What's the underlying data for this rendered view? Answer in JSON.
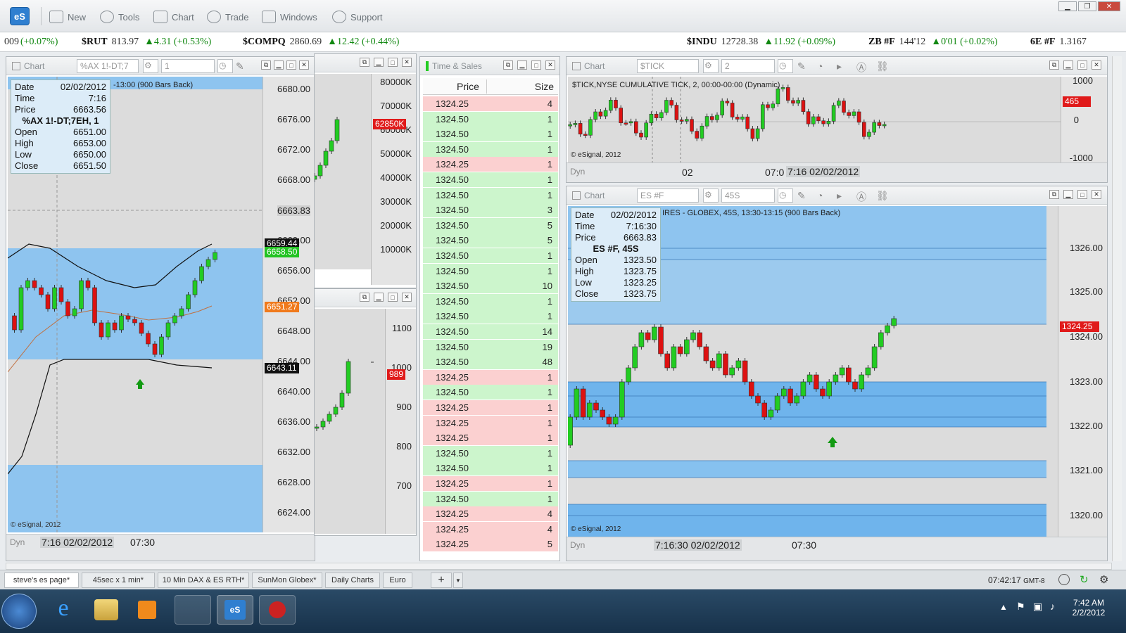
{
  "app": {
    "logo": "eS",
    "toolbar": [
      {
        "label": "New",
        "icon": "new-icon"
      },
      {
        "label": "Tools",
        "icon": "tools-icon"
      },
      {
        "label": "Chart",
        "icon": "chart-icon"
      },
      {
        "label": "Trade",
        "icon": "trade-icon"
      },
      {
        "label": "Windows",
        "icon": "windows-icon"
      },
      {
        "label": "Support",
        "icon": "help-icon"
      }
    ]
  },
  "ticker": [
    {
      "sym": "",
      "last": "009",
      "chg": "(+0.07%)"
    },
    {
      "sym": "$RUT",
      "last": "813.97",
      "chg": "▲4.31 (+0.53%)"
    },
    {
      "sym": "$COMPQ",
      "last": "2860.69",
      "chg": "▲12.42 (+0.44%)"
    },
    {
      "sym": "$INDU",
      "last": "12728.38",
      "chg": "▲11.92 (+0.09%)"
    },
    {
      "sym": "ZB #F",
      "last": "144'12",
      "chg": "▲0'01 (+0.02%)"
    },
    {
      "sym": "6E #F",
      "last": "1.3167",
      "chg": ""
    }
  ],
  "chart1": {
    "title": "Chart",
    "symbol": "%AX 1!-DT;7",
    "interval": "1",
    "legend": "-13:00 (900 Bars Back)",
    "tooltip": {
      "date_label": "Date",
      "date": "02/02/2012",
      "time_label": "Time",
      "time": "7:16",
      "price_label": "Price",
      "price": "6663.56",
      "name": "%AX 1!-DT;7EH, 1",
      "open_label": "Open",
      "open": "6651.00",
      "high_label": "High",
      "high": "6653.00",
      "low_label": "Low",
      "low": "6650.00",
      "close_label": "Close",
      "close": "6651.50"
    },
    "yticks": [
      "6680.00",
      "6676.00",
      "6672.00",
      "6668.00",
      "6663.83",
      "6660.00",
      "6656.00",
      "6652.00",
      "6648.00",
      "6644.00",
      "6640.00",
      "6636.00",
      "6632.00",
      "6628.00",
      "6624.00"
    ],
    "tags": [
      "6659.44",
      "6658.50",
      "6651.27",
      "6643.11"
    ],
    "copyright": "© eSignal, 2012",
    "dyn": "Dyn",
    "xtime": "7:16 02/02/2012",
    "xlabel": "07:30"
  },
  "chart2": {
    "yticks": [
      "80000K",
      "70000K",
      "60000K",
      "50000K",
      "40000K",
      "30000K",
      "20000K",
      "10000K"
    ],
    "tag": "62850K"
  },
  "chart3": {
    "yticks": [
      "1100",
      "1000",
      "900",
      "800",
      "700"
    ],
    "tag": "989"
  },
  "ts": {
    "title": "Time & Sales",
    "col_price": "Price",
    "col_size": "Size",
    "rows": [
      [
        "1324.25",
        "4",
        "dn"
      ],
      [
        "1324.50",
        "1",
        "up"
      ],
      [
        "1324.50",
        "1",
        "up"
      ],
      [
        "1324.50",
        "1",
        "up"
      ],
      [
        "1324.25",
        "1",
        "dn"
      ],
      [
        "1324.50",
        "1",
        "up"
      ],
      [
        "1324.50",
        "1",
        "up"
      ],
      [
        "1324.50",
        "3",
        "up"
      ],
      [
        "1324.50",
        "5",
        "up"
      ],
      [
        "1324.50",
        "5",
        "up"
      ],
      [
        "1324.50",
        "1",
        "up"
      ],
      [
        "1324.50",
        "1",
        "up"
      ],
      [
        "1324.50",
        "10",
        "up"
      ],
      [
        "1324.50",
        "1",
        "up"
      ],
      [
        "1324.50",
        "1",
        "up"
      ],
      [
        "1324.50",
        "14",
        "up"
      ],
      [
        "1324.50",
        "19",
        "up"
      ],
      [
        "1324.50",
        "48",
        "up"
      ],
      [
        "1324.25",
        "1",
        "dn"
      ],
      [
        "1324.50",
        "1",
        "up"
      ],
      [
        "1324.25",
        "1",
        "dn"
      ],
      [
        "1324.25",
        "1",
        "dn"
      ],
      [
        "1324.25",
        "1",
        "dn"
      ],
      [
        "1324.50",
        "1",
        "up"
      ],
      [
        "1324.50",
        "1",
        "up"
      ],
      [
        "1324.25",
        "1",
        "dn"
      ],
      [
        "1324.50",
        "1",
        "up"
      ],
      [
        "1324.25",
        "4",
        "dn"
      ],
      [
        "1324.25",
        "4",
        "dn"
      ],
      [
        "1324.25",
        "5",
        "dn"
      ]
    ]
  },
  "chart4": {
    "title": "Chart",
    "symbol": "$TICK",
    "interval": "2",
    "legend": "$TICK,NYSE CUMULATIVE TICK, 2, 00:00-00:00 (Dynamic)",
    "yticks": [
      "1000",
      "0",
      "-1000"
    ],
    "tag": "465",
    "copyright": "© eSignal, 2012",
    "dyn": "Dyn",
    "xlabel1": "02",
    "xlabel2": "07:0",
    "xtime": "7:16 02/02/2012"
  },
  "chart5": {
    "title": "Chart",
    "symbol": "ES #F",
    "interval": "45S",
    "legend": "IRES - GLOBEX, 45S, 13:30-13:15 (900 Bars Back)",
    "tooltip": {
      "date_label": "Date",
      "date": "02/02/2012",
      "time_label": "Time",
      "time": "7:16:30",
      "price_label": "Price",
      "price": "6663.83",
      "name": "ES #F, 45S",
      "open_label": "Open",
      "open": "1323.50",
      "high_label": "High",
      "high": "1323.75",
      "low_label": "Low",
      "low": "1323.25",
      "close_label": "Close",
      "close": "1323.75"
    },
    "yticks": [
      "1326.00",
      "1325.00",
      "1324.00",
      "1323.00",
      "1322.00",
      "1321.00",
      "1320.00"
    ],
    "tag": "1324.25",
    "copyright": "© eSignal, 2012",
    "dyn": "Dyn",
    "xtime": "7:16:30 02/02/2012",
    "xlabel": "07:30"
  },
  "tabs": [
    "steve's es page*",
    "45sec x 1 min*",
    "10 Min DAX & ES RTH*",
    "SunMon Globex*",
    "Daily Charts",
    "Euro",
    "+"
  ],
  "status": {
    "time": "07:42:17",
    "tz": "GMT-8"
  },
  "tray": {
    "time": "7:42 AM",
    "date": "2/2/2012"
  },
  "colors": {
    "up": "#22cc22",
    "down": "#dd1111",
    "band": "#8ec4ef"
  }
}
